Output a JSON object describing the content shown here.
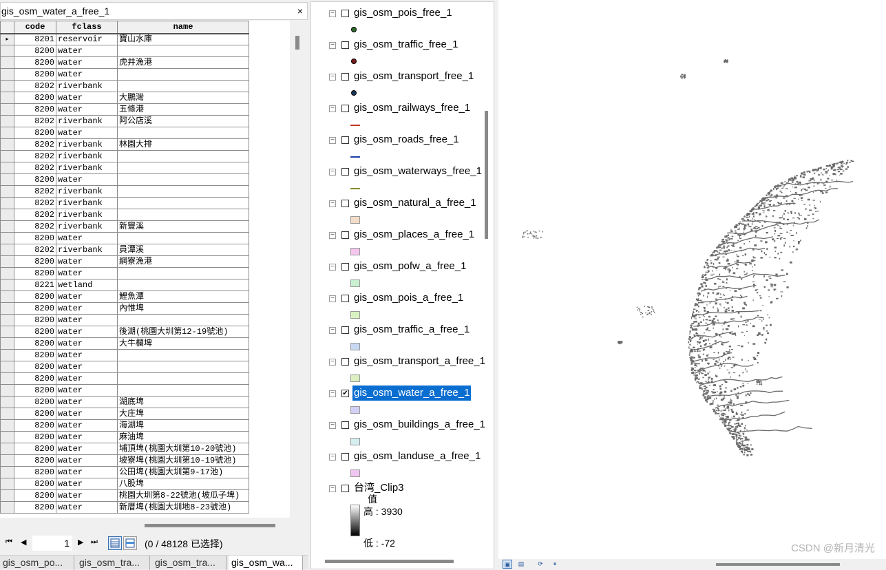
{
  "attr_table": {
    "title": "gis_osm_water_a_free_1",
    "close_glyph": "×",
    "columns": [
      "code",
      "fclass",
      "name"
    ],
    "rows": [
      [
        "8201",
        "reservoir",
        "寶山水庫"
      ],
      [
        "8200",
        "water",
        ""
      ],
      [
        "8200",
        "water",
        "虎井漁港"
      ],
      [
        "8200",
        "water",
        ""
      ],
      [
        "8202",
        "riverbank",
        ""
      ],
      [
        "8200",
        "water",
        "大鵬灣"
      ],
      [
        "8200",
        "water",
        "五條港"
      ],
      [
        "8202",
        "riverbank",
        "阿公店溪"
      ],
      [
        "8200",
        "water",
        ""
      ],
      [
        "8202",
        "riverbank",
        "林園大排"
      ],
      [
        "8202",
        "riverbank",
        ""
      ],
      [
        "8202",
        "riverbank",
        ""
      ],
      [
        "8200",
        "water",
        ""
      ],
      [
        "8202",
        "riverbank",
        ""
      ],
      [
        "8202",
        "riverbank",
        ""
      ],
      [
        "8202",
        "riverbank",
        ""
      ],
      [
        "8202",
        "riverbank",
        "新豐溪"
      ],
      [
        "8200",
        "water",
        ""
      ],
      [
        "8202",
        "riverbank",
        "員潭溪"
      ],
      [
        "8200",
        "water",
        "網寮漁港"
      ],
      [
        "8200",
        "water",
        ""
      ],
      [
        "8221",
        "wetland",
        ""
      ],
      [
        "8200",
        "water",
        "鯉魚潭"
      ],
      [
        "8200",
        "water",
        "內惟埤"
      ],
      [
        "8200",
        "water",
        ""
      ],
      [
        "8200",
        "water",
        "後湖(桃園大圳第12-19號池)"
      ],
      [
        "8200",
        "water",
        "大牛欄埤"
      ],
      [
        "8200",
        "water",
        ""
      ],
      [
        "8200",
        "water",
        ""
      ],
      [
        "8200",
        "water",
        ""
      ],
      [
        "8200",
        "water",
        ""
      ],
      [
        "8200",
        "water",
        "湖底埤"
      ],
      [
        "8200",
        "water",
        "大庄埤"
      ],
      [
        "8200",
        "water",
        "海湖埤"
      ],
      [
        "8200",
        "water",
        "麻油埤"
      ],
      [
        "8200",
        "water",
        "埔頂埤(桃園大圳第10-20號池)"
      ],
      [
        "8200",
        "water",
        "坡寮埤(桃園大圳第10-19號池)"
      ],
      [
        "8200",
        "water",
        "公田埤(桃園大圳第9-17池)"
      ],
      [
        "8200",
        "water",
        "八股埤"
      ],
      [
        "8200",
        "water",
        "桃園大圳第8-22號池(坡瓜子埤)"
      ],
      [
        "8200",
        "water",
        "新厝埤(桃園大圳地8-23號池)"
      ]
    ],
    "current_row_marker": "▸",
    "page_value": "1",
    "selection_text": "(0 / 48128 已选择)",
    "nav": {
      "first": "⏮",
      "prev": "◀",
      "next": "▶",
      "last": "⏭"
    }
  },
  "bottom_tabs": [
    {
      "label": "gis_osm_po...",
      "active": false
    },
    {
      "label": "gis_osm_tra...",
      "active": false
    },
    {
      "label": "gis_osm_tra...",
      "active": false
    },
    {
      "label": "gis_osm_wa...",
      "active": true
    }
  ],
  "toc": {
    "layers": [
      {
        "name": "gis_osm_pois_free_1",
        "checked": false,
        "symbol": "point",
        "color": "#2f6b2f"
      },
      {
        "name": "gis_osm_traffic_free_1",
        "checked": false,
        "symbol": "point",
        "color": "#7a1c1c"
      },
      {
        "name": "gis_osm_transport_free_1",
        "checked": false,
        "symbol": "point",
        "color": "#1c3a5e"
      },
      {
        "name": "gis_osm_railways_free_1",
        "checked": false,
        "symbol": "line",
        "color": "#c0392b"
      },
      {
        "name": "gis_osm_roads_free_1",
        "checked": false,
        "symbol": "line",
        "color": "#1f3fa8"
      },
      {
        "name": "gis_osm_waterways_free_1",
        "checked": false,
        "symbol": "line",
        "color": "#8a8a2a"
      },
      {
        "name": "gis_osm_natural_a_free_1",
        "checked": false,
        "symbol": "poly",
        "color": "#f3dcc9"
      },
      {
        "name": "gis_osm_places_a_free_1",
        "checked": false,
        "symbol": "poly",
        "color": "#f4c6ef"
      },
      {
        "name": "gis_osm_pofw_a_free_1",
        "checked": false,
        "symbol": "poly",
        "color": "#c9f0cf"
      },
      {
        "name": "gis_osm_pois_a_free_1",
        "checked": false,
        "symbol": "poly",
        "color": "#d9f2c2"
      },
      {
        "name": "gis_osm_traffic_a_free_1",
        "checked": false,
        "symbol": "poly",
        "color": "#c8d8f2"
      },
      {
        "name": "gis_osm_transport_a_free_1",
        "checked": false,
        "symbol": "poly",
        "color": "#dcefc0"
      },
      {
        "name": "gis_osm_water_a_free_1",
        "checked": true,
        "selected": true,
        "symbol": "poly",
        "color": "#d2d0f4"
      },
      {
        "name": "gis_osm_buildings_a_free_1",
        "checked": false,
        "symbol": "poly",
        "color": "#d6eef0"
      },
      {
        "name": "gis_osm_landuse_a_free_1",
        "checked": false,
        "symbol": "poly",
        "color": "#f0c6f0"
      },
      {
        "name": "台湾_Clip3",
        "checked": false,
        "symbol": "raster",
        "color": "#000000"
      }
    ],
    "raster_legend": {
      "field": "值",
      "high": "高 : 3930",
      "low": "低 : -72"
    }
  },
  "map": {
    "watermark": "CSDN @新月清光",
    "feature_color": "#6b6b6b",
    "buttons": {
      "layout_view": "▣",
      "data_view": "▤",
      "refresh": "⟳",
      "pause": "⏸"
    }
  }
}
